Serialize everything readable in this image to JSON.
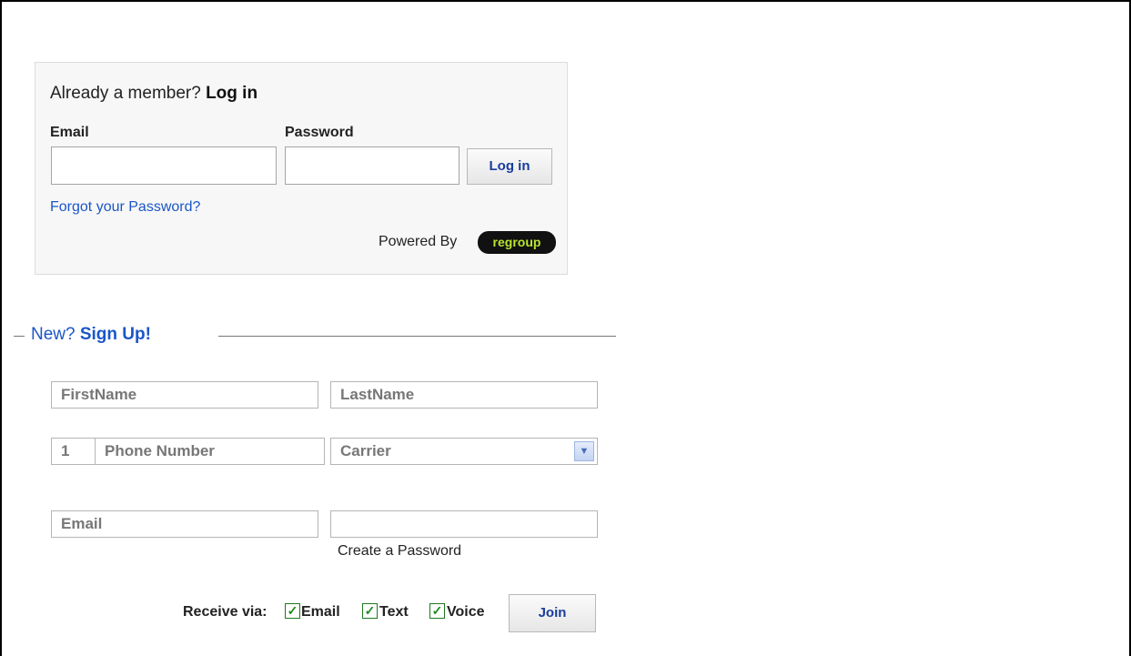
{
  "login": {
    "title_prefix": "Already a member? ",
    "title_action": "Log in",
    "email_label": "Email",
    "password_label": "Password",
    "email_value": "",
    "password_value": "",
    "login_button": "Log in",
    "forgot_link": "Forgot your Password?",
    "powered_by": "Powered By",
    "logo_text": "regroup"
  },
  "signup": {
    "heading_prefix": "New? ",
    "heading_action": "Sign Up!",
    "first_name_placeholder": "FirstName",
    "last_name_placeholder": "LastName",
    "country_code": "1",
    "phone_placeholder": "Phone Number",
    "carrier_selected": "Carrier",
    "email_placeholder": "Email",
    "password_value": "",
    "create_password_label": "Create a Password",
    "receive_via_label": "Receive via:",
    "options": [
      {
        "label": "Email",
        "checked": true
      },
      {
        "label": "Text",
        "checked": true
      },
      {
        "label": "Voice",
        "checked": true
      }
    ],
    "join_button": "Join"
  },
  "colors": {
    "link": "#1a56c8",
    "button_text": "#1a3d9c",
    "logo_text": "#b8e62e",
    "checkbox": "#1e8c1e"
  },
  "icons": {
    "dropdown": "chevron-down-icon",
    "check": "check-icon"
  }
}
